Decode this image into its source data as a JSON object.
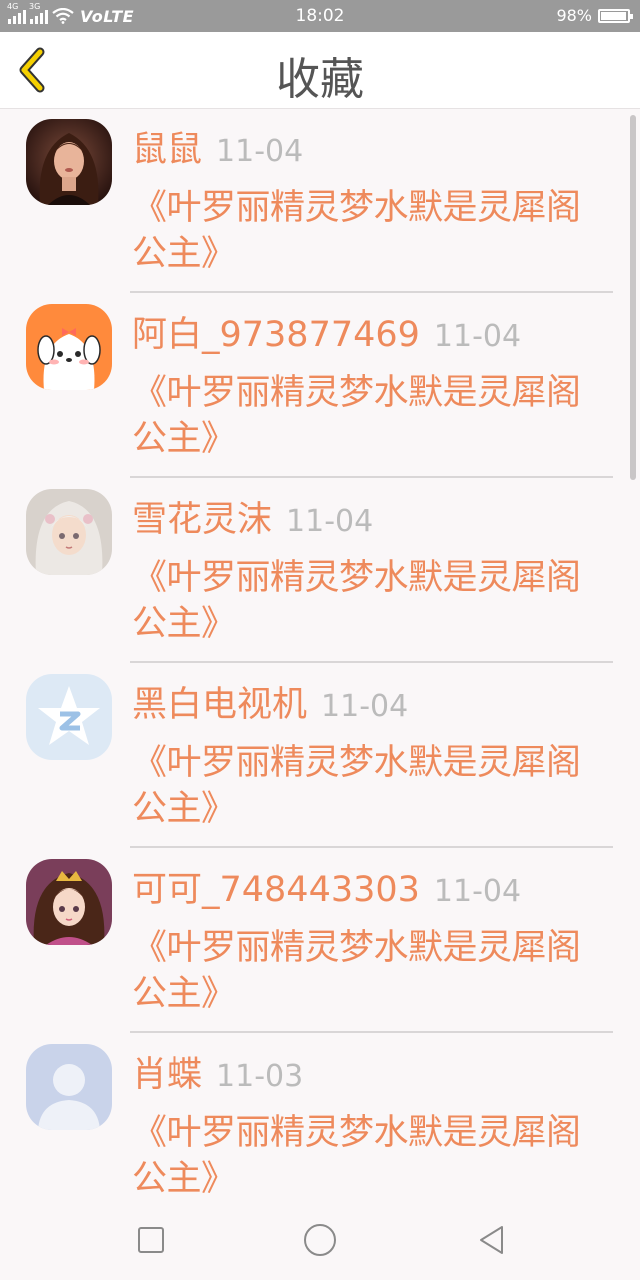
{
  "status_bar": {
    "network_1": "4G",
    "network_2": "3G",
    "carrier": "VoLTE",
    "time": "18:02",
    "battery_text": "98%",
    "battery_level": 0.98
  },
  "header": {
    "title": "收藏",
    "back_icon": "chevron-left-icon",
    "accent_color": "#f5d000"
  },
  "colors": {
    "name": "#ee8a5c",
    "date": "#bbbbbb",
    "content": "#ee8a5c"
  },
  "items": [
    {
      "name": "鼠鼠",
      "date": "11-04",
      "content": "《叶罗丽精灵梦水默是灵犀阁公主》",
      "avatar": "woman-photo"
    },
    {
      "name": "阿白_973877469",
      "date": "11-04",
      "content": "《叶罗丽精灵梦水默是灵犀阁公主》",
      "avatar": "cartoon-dog"
    },
    {
      "name": "雪花灵沫",
      "date": "11-04",
      "content": "《叶罗丽精灵梦水默是灵犀阁公主》",
      "avatar": "anime-girl-white-hair"
    },
    {
      "name": "黑白电视机",
      "date": "11-04",
      "content": "《叶罗丽精灵梦水默是灵犀阁公主》",
      "avatar": "qq-zone-star"
    },
    {
      "name": "可可_748443303",
      "date": "11-04",
      "content": "《叶罗丽精灵梦水默是灵犀阁公主》",
      "avatar": "anime-girl-crown"
    },
    {
      "name": "肖蝶",
      "date": "11-03",
      "content": "《叶罗丽精灵梦水默是灵犀阁公主》",
      "avatar": "default-person"
    }
  ],
  "nav_bar": {
    "recent": "square-icon",
    "home": "circle-icon",
    "back": "triangle-back-icon"
  }
}
